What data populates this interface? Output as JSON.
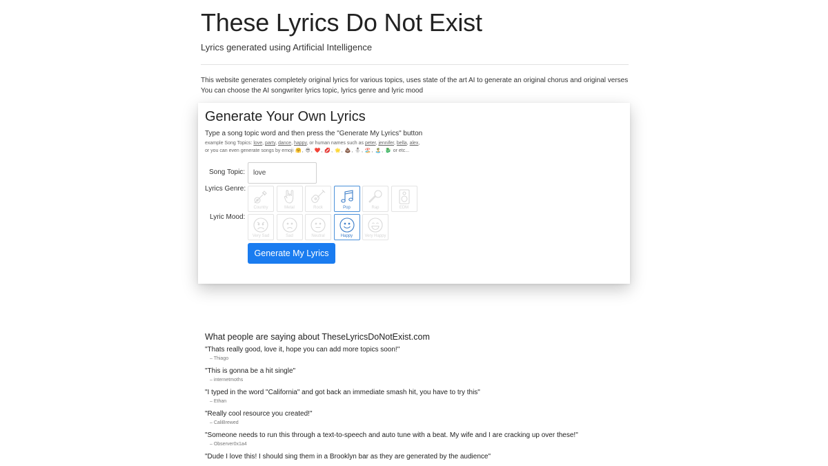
{
  "header": {
    "title": "These Lyrics Do Not Exist",
    "subtitle": "Lyrics generated using Artificial Intelligence"
  },
  "description": {
    "line1": "This website generates completely original lyrics for various topics, uses state of the art AI to generate an original chorus and original verses",
    "line2": "You can choose the AI songwriter lyrics topic, lyrics genre and lyric mood"
  },
  "generator": {
    "title": "Generate Your Own Lyrics",
    "instructions": "Type a song topic word and then press the \"Generate My Lyrics\" button",
    "examples_prefix": "example Song Topics:",
    "example_topics": [
      "love",
      "party",
      "dance",
      "happy"
    ],
    "names_prefix": ", or human names such as",
    "example_names": [
      "peter",
      "jennifer",
      "bella",
      "alex"
    ],
    "emoji_prefix": "or you can even generate songs by emoji",
    "emojis": [
      "🤗",
      "😎",
      "❤️",
      "💋",
      "🌟",
      "💩",
      "⛄",
      "🏖️",
      "🏝️",
      "🐉"
    ],
    "emoji_suffix": "or etc...",
    "topic_label": "Song Topic:",
    "topic_value": "love",
    "genre_label": "Lyrics Genre:",
    "genres": [
      {
        "label": "Country",
        "icon": "country-icon",
        "selected": false
      },
      {
        "label": "Metal",
        "icon": "metal-hand-icon",
        "selected": false
      },
      {
        "label": "Rock",
        "icon": "guitar-icon",
        "selected": false
      },
      {
        "label": "Pop",
        "icon": "music-note-icon",
        "selected": true
      },
      {
        "label": "Rap",
        "icon": "microphone-icon",
        "selected": false
      },
      {
        "label": "EDM",
        "icon": "speaker-icon",
        "selected": false
      }
    ],
    "mood_label": "Lyric Mood:",
    "moods": [
      {
        "label": "Very Sad",
        "icon": "very-sad-face-icon",
        "selected": false
      },
      {
        "label": "Sad",
        "icon": "sad-face-icon",
        "selected": false
      },
      {
        "label": "Neutral",
        "icon": "neutral-face-icon",
        "selected": false
      },
      {
        "label": "Happy",
        "icon": "happy-face-icon",
        "selected": true
      },
      {
        "label": "Very Happy",
        "icon": "very-happy-face-icon",
        "selected": false
      }
    ],
    "button_label": "Generate My Lyrics"
  },
  "testimonials": {
    "title": "What people are saying about TheseLyricsDoNotExist.com",
    "items": [
      {
        "quote": "\"Thats really good, love it, hope you can add more topics soon!\"",
        "author": "– Thiago"
      },
      {
        "quote": "\"This is gonna be a hit single\"",
        "author": "– internetmoths"
      },
      {
        "quote": "\"I typed in the word \"California\" and got back an immediate smash hit, you have to try this\"",
        "author": "– Ethan"
      },
      {
        "quote": "\"Really cool resource you created!\"",
        "author": "– CaliBrewed"
      },
      {
        "quote": "\"Someone needs to run this through a text-to-speech and auto tune with a beat. My wife and I are cracking up over these!\"",
        "author": "– Observer0x1a4"
      },
      {
        "quote": "\"Dude I love this! I should sing them in a Brooklyn bar as they are generated by the audience\"",
        "author": ""
      }
    ]
  },
  "colors": {
    "accent": "#1a7cf0",
    "selected_border": "#4a90d9",
    "inactive_icon": "#d9d9d9"
  }
}
